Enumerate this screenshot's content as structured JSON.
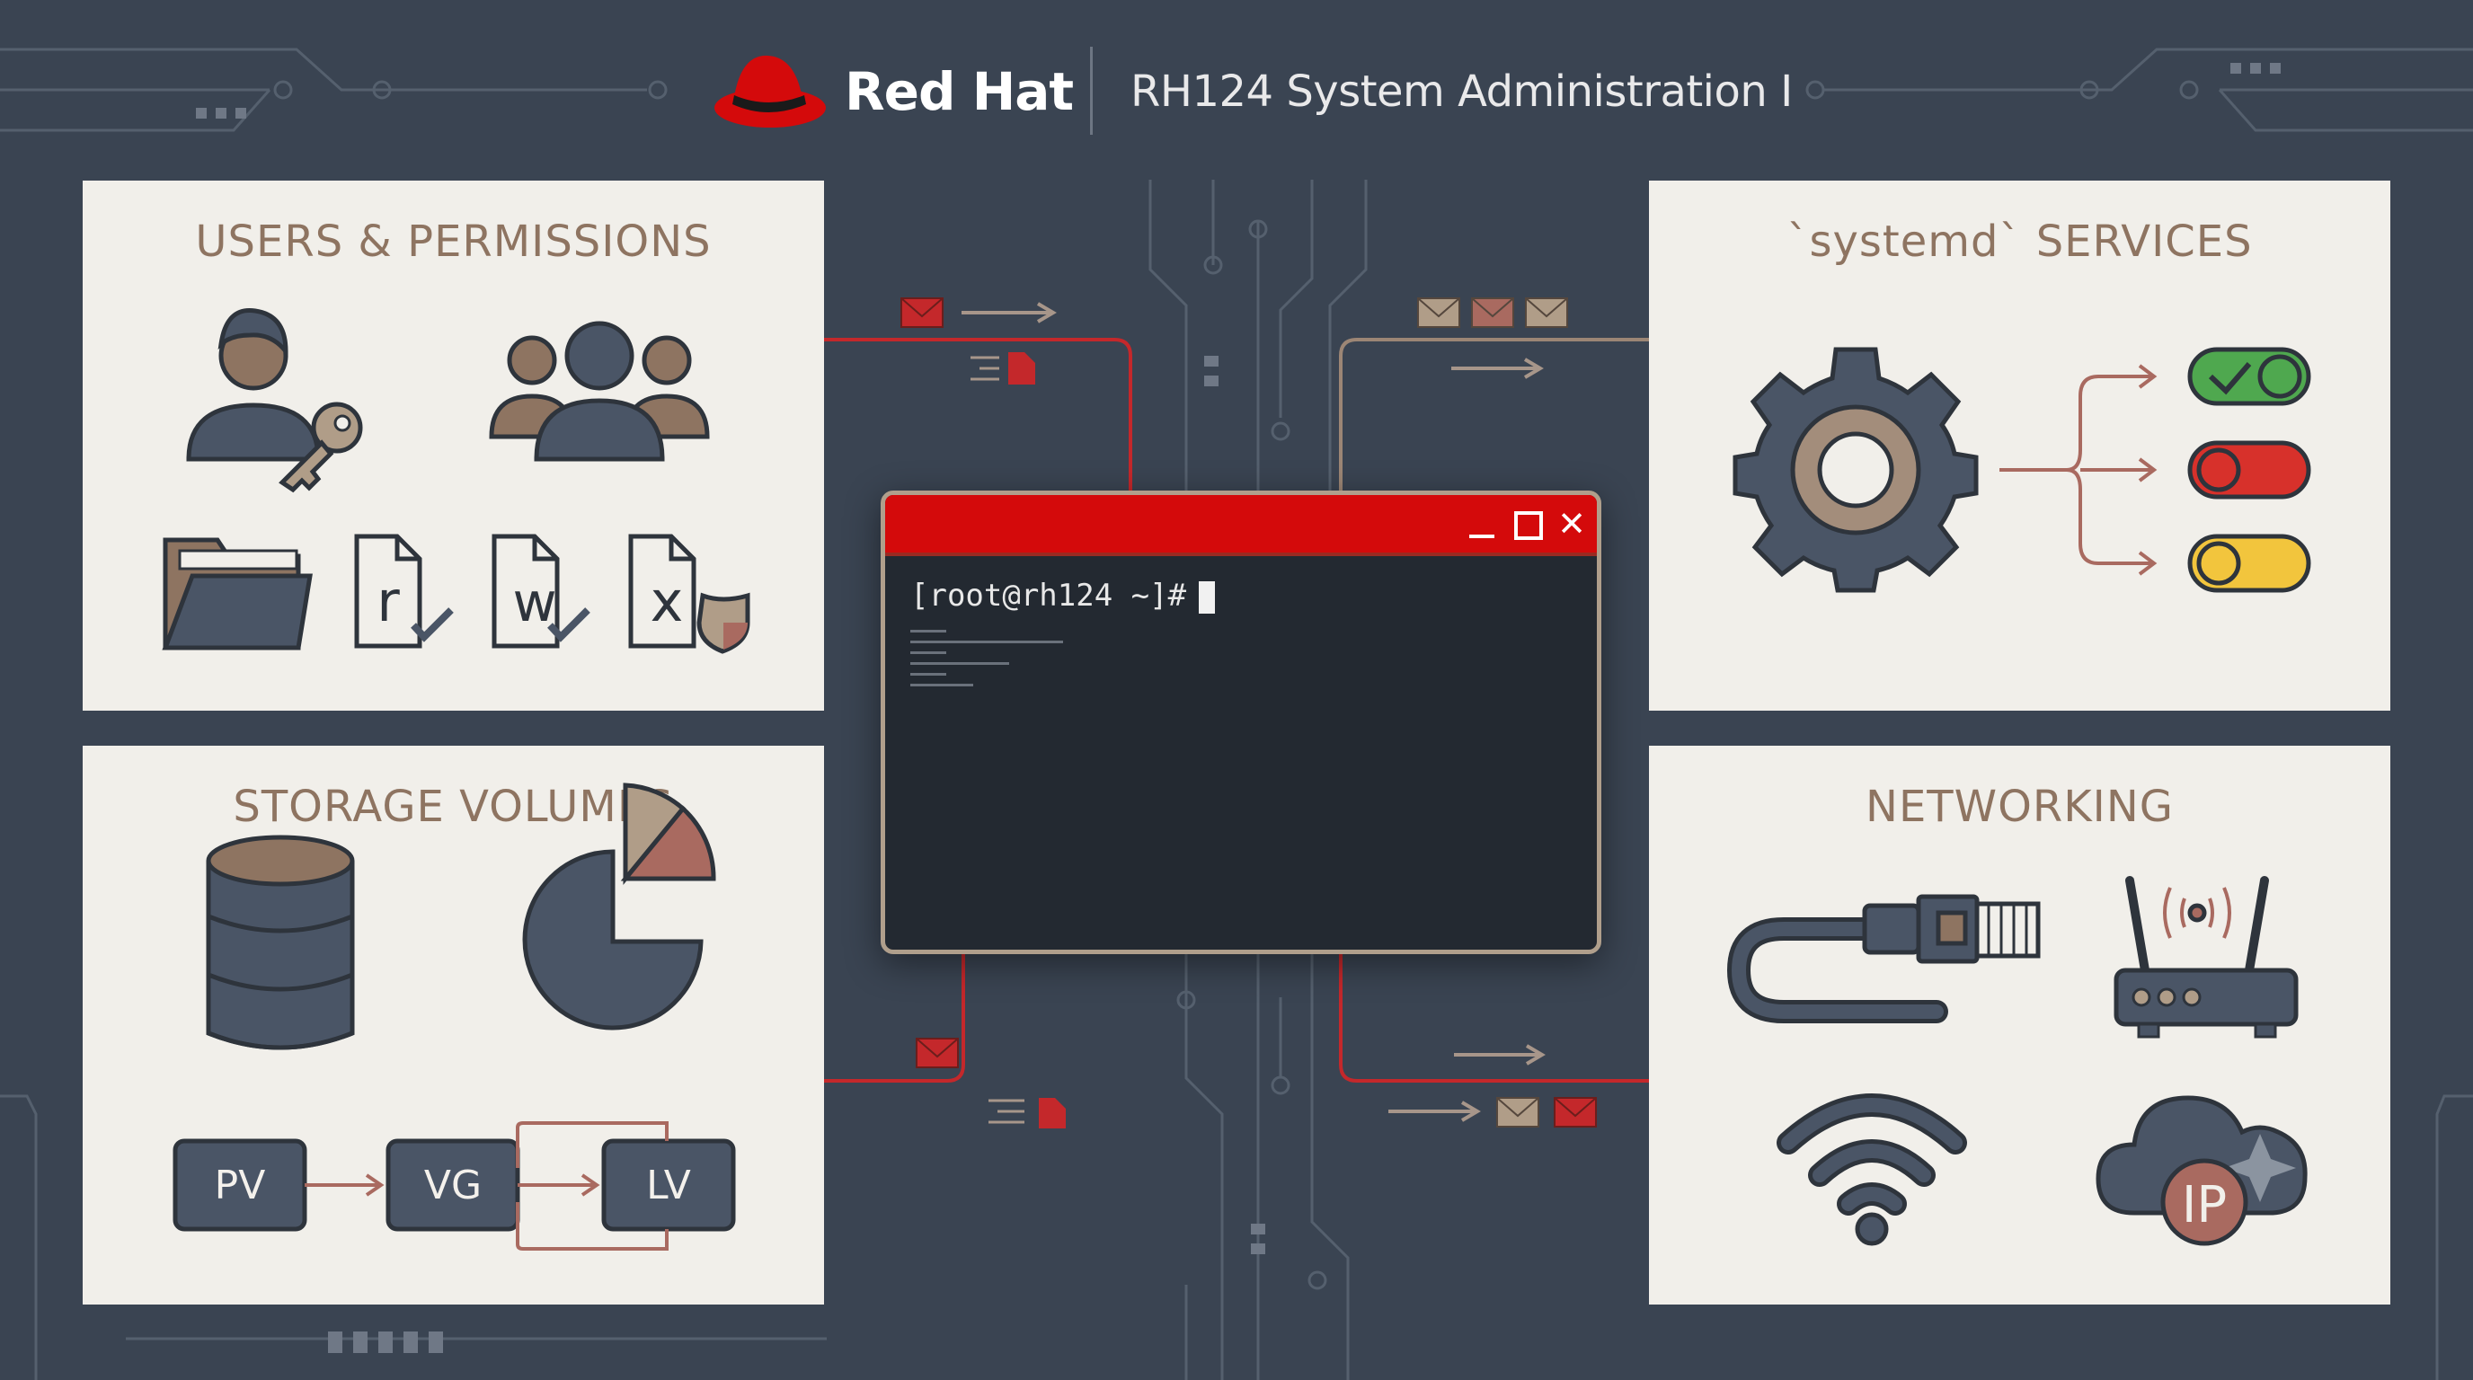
{
  "header": {
    "brand": "Red Hat",
    "course": "RH124 System Administration I"
  },
  "panels": {
    "users": {
      "title": "USERS & PERMISSIONS",
      "perms": [
        "r",
        "w",
        "x"
      ]
    },
    "services": {
      "title": "`systemd` SERVICES"
    },
    "storage": {
      "title": "STORAGE VOLUMES",
      "lvm": [
        "PV",
        "VG",
        "LV"
      ]
    },
    "networking": {
      "title": "NETWORKING",
      "ip_label": "IP"
    }
  },
  "terminal": {
    "prompt": "[root@rh124 ~]#"
  },
  "colors": {
    "background": "#3a4452",
    "accent_red": "#d40a0b",
    "panel": "#f1efea",
    "title_brown": "#8e7461",
    "icon_slate": "#4a5566"
  },
  "icons": [
    "red-hat-logo",
    "user-key-icon",
    "user-group-icon",
    "folder-icon",
    "read-permission-icon",
    "write-permission-icon",
    "execute-permission-icon",
    "gear-icon",
    "toggle-on-icon",
    "toggle-off-icon",
    "toggle-pending-icon",
    "database-icon",
    "pie-chart-icon",
    "ethernet-cable-icon",
    "router-icon",
    "wifi-icon",
    "cloud-ip-icon",
    "envelope-icon",
    "document-icon"
  ]
}
